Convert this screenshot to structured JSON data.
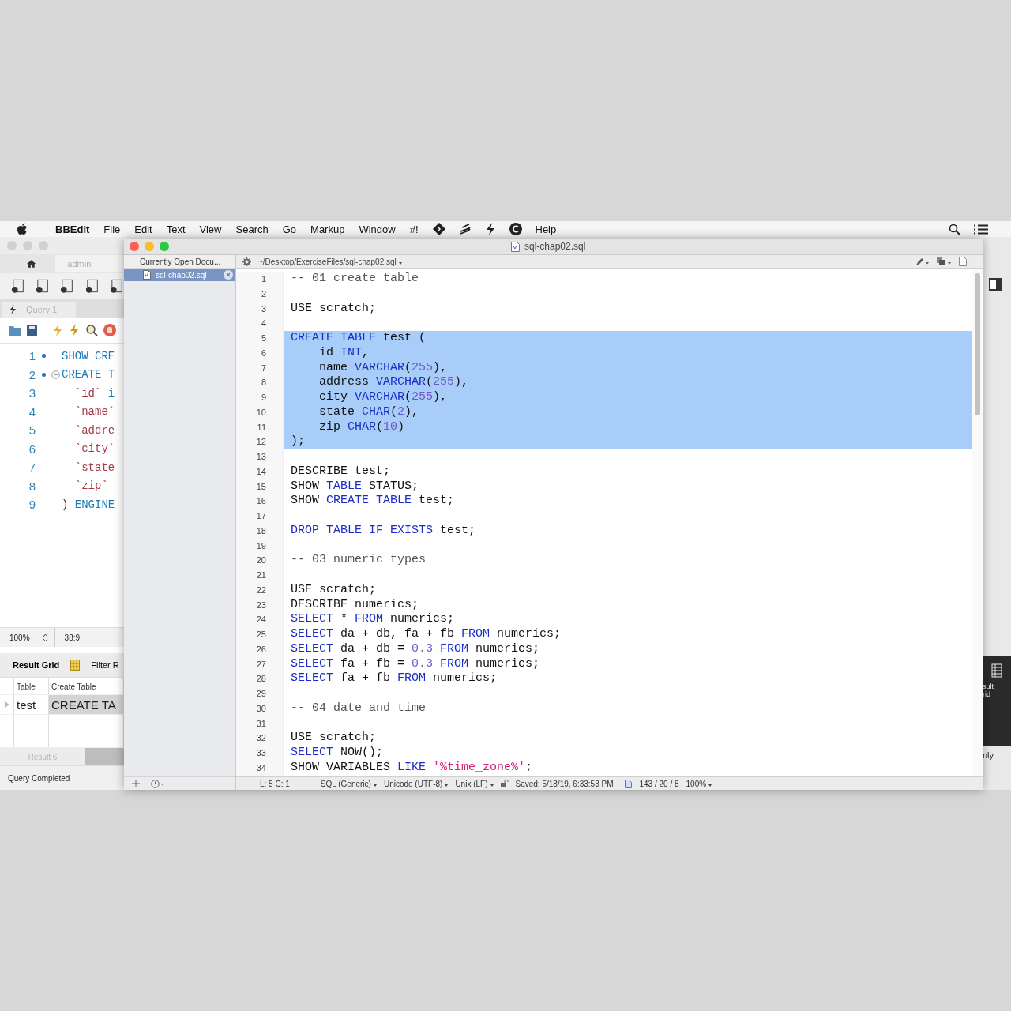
{
  "menu_bar": {
    "app": "BBEdit",
    "items": [
      "File",
      "Edit",
      "Text",
      "View",
      "Search",
      "Go",
      "Markup",
      "Window",
      "#!"
    ],
    "help": "Help"
  },
  "workbench_window": {
    "connection_tab": "admin",
    "query_tab": "Query 1",
    "code_lines": [
      {
        "number": "1",
        "dot": true,
        "fold": false,
        "tokens": [
          {
            "kind": "kw",
            "text": "SHOW CRE"
          }
        ]
      },
      {
        "number": "2",
        "dot": true,
        "fold": true,
        "tokens": [
          {
            "kind": "kw",
            "text": "CREATE T"
          }
        ]
      },
      {
        "number": "3",
        "dot": false,
        "fold": false,
        "tokens": [
          {
            "kind": "name",
            "text": "  `id`"
          },
          {
            "kind": "kw",
            "text": " i"
          }
        ]
      },
      {
        "number": "4",
        "dot": false,
        "fold": false,
        "tokens": [
          {
            "kind": "name",
            "text": "  `name`"
          }
        ]
      },
      {
        "number": "5",
        "dot": false,
        "fold": false,
        "tokens": [
          {
            "kind": "name",
            "text": "  `addre"
          }
        ]
      },
      {
        "number": "6",
        "dot": false,
        "fold": false,
        "tokens": [
          {
            "kind": "name",
            "text": "  `city`"
          }
        ]
      },
      {
        "number": "7",
        "dot": false,
        "fold": false,
        "tokens": [
          {
            "kind": "name",
            "text": "  `state"
          }
        ]
      },
      {
        "number": "8",
        "dot": false,
        "fold": false,
        "tokens": [
          {
            "kind": "name",
            "text": "  `zip`"
          }
        ]
      },
      {
        "number": "9",
        "dot": false,
        "fold": false,
        "tokens": [
          {
            "kind": "plain",
            "text": ") "
          },
          {
            "kind": "kw",
            "text": "ENGINE"
          }
        ]
      }
    ],
    "zoom": "100%",
    "position": "38:9",
    "result_title": "Result Grid",
    "filter_label": "Filter R",
    "grid": {
      "columns": [
        "Table",
        "Create Table"
      ],
      "rows": [
        [
          "test",
          "CREATE TA"
        ]
      ]
    },
    "result_tab": "Result 6",
    "status": "Query Completed",
    "side_panel": {
      "label_lines": [
        "sult",
        "rid"
      ],
      "option": "nly"
    }
  },
  "editor_window": {
    "title": "sql-chap02.sql",
    "sidebar": {
      "header": "Currently Open Docu...",
      "documents": [
        {
          "name": "sql-chap02.sql",
          "selected": true
        }
      ]
    },
    "path": "~/Desktop/ExerciseFiles/sql-chap02.sql",
    "lines": [
      {
        "number": "1",
        "selected": false,
        "tokens": [
          {
            "kind": "comment",
            "text": "-- 01 create table"
          }
        ]
      },
      {
        "number": "2",
        "selected": false
      },
      {
        "number": "3",
        "selected": false,
        "tokens": [
          {
            "kind": "plain",
            "text": "USE scratch;"
          }
        ]
      },
      {
        "number": "4",
        "selected": false
      },
      {
        "number": "5",
        "selected": true,
        "tokens": [
          {
            "kind": "kw",
            "text": "CREATE TABLE"
          },
          {
            "kind": "plain",
            "text": " test ("
          }
        ]
      },
      {
        "number": "6",
        "selected": true,
        "tokens": [
          {
            "kind": "plain",
            "text": "    id "
          },
          {
            "kind": "kw",
            "text": "INT"
          },
          {
            "kind": "plain",
            "text": ","
          }
        ]
      },
      {
        "number": "7",
        "selected": true,
        "tokens": [
          {
            "kind": "plain",
            "text": "    name "
          },
          {
            "kind": "kw",
            "text": "VARCHAR"
          },
          {
            "kind": "plain",
            "text": "("
          },
          {
            "kind": "num",
            "text": "255"
          },
          {
            "kind": "plain",
            "text": "),"
          }
        ]
      },
      {
        "number": "8",
        "selected": true,
        "tokens": [
          {
            "kind": "plain",
            "text": "    address "
          },
          {
            "kind": "kw",
            "text": "VARCHAR"
          },
          {
            "kind": "plain",
            "text": "("
          },
          {
            "kind": "num",
            "text": "255"
          },
          {
            "kind": "plain",
            "text": "),"
          }
        ]
      },
      {
        "number": "9",
        "selected": true,
        "tokens": [
          {
            "kind": "plain",
            "text": "    city "
          },
          {
            "kind": "kw",
            "text": "VARCHAR"
          },
          {
            "kind": "plain",
            "text": "("
          },
          {
            "kind": "num",
            "text": "255"
          },
          {
            "kind": "plain",
            "text": "),"
          }
        ]
      },
      {
        "number": "10",
        "selected": true,
        "tokens": [
          {
            "kind": "plain",
            "text": "    state "
          },
          {
            "kind": "kw",
            "text": "CHAR"
          },
          {
            "kind": "plain",
            "text": "("
          },
          {
            "kind": "num",
            "text": "2"
          },
          {
            "kind": "plain",
            "text": "),"
          }
        ]
      },
      {
        "number": "11",
        "selected": true,
        "tokens": [
          {
            "kind": "plain",
            "text": "    zip "
          },
          {
            "kind": "kw",
            "text": "CHAR"
          },
          {
            "kind": "plain",
            "text": "("
          },
          {
            "kind": "num",
            "text": "10"
          },
          {
            "kind": "plain",
            "text": ")"
          }
        ]
      },
      {
        "number": "12",
        "selected": true,
        "tokens": [
          {
            "kind": "plain",
            "text": ");"
          }
        ]
      },
      {
        "number": "13",
        "selected": false
      },
      {
        "number": "14",
        "selected": false,
        "tokens": [
          {
            "kind": "plain",
            "text": "DESCRIBE test;"
          }
        ]
      },
      {
        "number": "15",
        "selected": false,
        "tokens": [
          {
            "kind": "plain",
            "text": "SHOW "
          },
          {
            "kind": "kw",
            "text": "TABLE"
          },
          {
            "kind": "plain",
            "text": " STATUS;"
          }
        ]
      },
      {
        "number": "16",
        "selected": false,
        "tokens": [
          {
            "kind": "plain",
            "text": "SHOW "
          },
          {
            "kind": "kw",
            "text": "CREATE TABLE"
          },
          {
            "kind": "plain",
            "text": " test;"
          }
        ]
      },
      {
        "number": "17",
        "selected": false
      },
      {
        "number": "18",
        "selected": false,
        "tokens": [
          {
            "kind": "kw",
            "text": "DROP TABLE IF EXISTS"
          },
          {
            "kind": "plain",
            "text": " test;"
          }
        ]
      },
      {
        "number": "19",
        "selected": false
      },
      {
        "number": "20",
        "selected": false,
        "tokens": [
          {
            "kind": "comment",
            "text": "-- 03 numeric types"
          }
        ]
      },
      {
        "number": "21",
        "selected": false
      },
      {
        "number": "22",
        "selected": false,
        "tokens": [
          {
            "kind": "plain",
            "text": "USE scratch;"
          }
        ]
      },
      {
        "number": "23",
        "selected": false,
        "tokens": [
          {
            "kind": "plain",
            "text": "DESCRIBE numerics;"
          }
        ]
      },
      {
        "number": "24",
        "selected": false,
        "tokens": [
          {
            "kind": "kw",
            "text": "SELECT"
          },
          {
            "kind": "plain",
            "text": " * "
          },
          {
            "kind": "kw",
            "text": "FROM"
          },
          {
            "kind": "plain",
            "text": " numerics;"
          }
        ]
      },
      {
        "number": "25",
        "selected": false,
        "tokens": [
          {
            "kind": "kw",
            "text": "SELECT"
          },
          {
            "kind": "plain",
            "text": " da + db, fa + fb "
          },
          {
            "kind": "kw",
            "text": "FROM"
          },
          {
            "kind": "plain",
            "text": " numerics;"
          }
        ]
      },
      {
        "number": "26",
        "selected": false,
        "tokens": [
          {
            "kind": "kw",
            "text": "SELECT"
          },
          {
            "kind": "plain",
            "text": " da + db = "
          },
          {
            "kind": "num",
            "text": "0.3"
          },
          {
            "kind": "kw",
            "text": " FROM"
          },
          {
            "kind": "plain",
            "text": " numerics;"
          }
        ]
      },
      {
        "number": "27",
        "selected": false,
        "tokens": [
          {
            "kind": "kw",
            "text": "SELECT"
          },
          {
            "kind": "plain",
            "text": " fa + fb = "
          },
          {
            "kind": "num",
            "text": "0.3"
          },
          {
            "kind": "kw",
            "text": " FROM"
          },
          {
            "kind": "plain",
            "text": " numerics;"
          }
        ]
      },
      {
        "number": "28",
        "selected": false,
        "tokens": [
          {
            "kind": "kw",
            "text": "SELECT"
          },
          {
            "kind": "plain",
            "text": " fa + fb "
          },
          {
            "kind": "kw",
            "text": "FROM"
          },
          {
            "kind": "plain",
            "text": " numerics;"
          }
        ]
      },
      {
        "number": "29",
        "selected": false
      },
      {
        "number": "30",
        "selected": false,
        "tokens": [
          {
            "kind": "comment",
            "text": "-- 04 date and time"
          }
        ]
      },
      {
        "number": "31",
        "selected": false
      },
      {
        "number": "32",
        "selected": false,
        "tokens": [
          {
            "kind": "plain",
            "text": "USE scratch;"
          }
        ]
      },
      {
        "number": "33",
        "selected": false,
        "tokens": [
          {
            "kind": "kw",
            "text": "SELECT"
          },
          {
            "kind": "plain",
            "text": " NOW();"
          }
        ]
      },
      {
        "number": "34",
        "selected": false,
        "tokens": [
          {
            "kind": "plain",
            "text": "SHOW VARIABLES "
          },
          {
            "kind": "kw",
            "text": "LIKE"
          },
          {
            "kind": "str",
            "text": " '%time_zone%'"
          },
          {
            "kind": "plain",
            "text": ";"
          }
        ]
      }
    ],
    "status_bar": {
      "position": "L: 5 C: 1",
      "language": "SQL (Generic)",
      "encoding": "Unicode (UTF-8)",
      "line_endings": "Unix (LF)",
      "saved": "Saved: 5/18/19, 6:33:53 PM",
      "counts": "143 / 20 / 8",
      "zoom": "100%"
    }
  }
}
